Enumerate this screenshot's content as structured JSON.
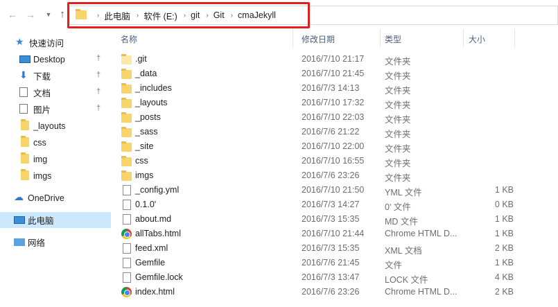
{
  "address_bar": {
    "breadcrumbs": [
      "此电脑",
      "软件 (E:)",
      "git",
      "Git",
      "cmaJekyll"
    ]
  },
  "sidebar": {
    "items": [
      {
        "label": "快速访问",
        "icon": "star-icon",
        "pinned": false,
        "selected": false
      },
      {
        "label": "Desktop",
        "icon": "desktop-icon",
        "pinned": true,
        "selected": false
      },
      {
        "label": "下载",
        "icon": "download-icon",
        "pinned": true,
        "selected": false
      },
      {
        "label": "文档",
        "icon": "document-icon",
        "pinned": true,
        "selected": false
      },
      {
        "label": "图片",
        "icon": "pictures-icon",
        "pinned": true,
        "selected": false
      },
      {
        "label": "_layouts",
        "icon": "folder-icon",
        "pinned": false,
        "selected": false
      },
      {
        "label": "css",
        "icon": "folder-icon",
        "pinned": false,
        "selected": false
      },
      {
        "label": "img",
        "icon": "folder-icon",
        "pinned": false,
        "selected": false
      },
      {
        "label": "imgs",
        "icon": "folder-icon",
        "pinned": false,
        "selected": false
      },
      {
        "label": "OneDrive",
        "icon": "cloud-icon",
        "pinned": false,
        "selected": false
      },
      {
        "label": "此电脑",
        "icon": "computer-icon",
        "pinned": false,
        "selected": true
      },
      {
        "label": "网络",
        "icon": "network-icon",
        "pinned": false,
        "selected": false
      }
    ]
  },
  "columns": {
    "name": "名称",
    "date": "修改日期",
    "type": "类型",
    "size": "大小"
  },
  "files": [
    {
      "name": ".git",
      "date": "2016/7/10 21:17",
      "type": "文件夹",
      "size": "",
      "icon": "folder-light"
    },
    {
      "name": "_data",
      "date": "2016/7/10 21:45",
      "type": "文件夹",
      "size": "",
      "icon": "folder"
    },
    {
      "name": "_includes",
      "date": "2016/7/3 14:13",
      "type": "文件夹",
      "size": "",
      "icon": "folder"
    },
    {
      "name": "_layouts",
      "date": "2016/7/10 17:32",
      "type": "文件夹",
      "size": "",
      "icon": "folder"
    },
    {
      "name": "_posts",
      "date": "2016/7/10 22:03",
      "type": "文件夹",
      "size": "",
      "icon": "folder"
    },
    {
      "name": "_sass",
      "date": "2016/7/6 21:22",
      "type": "文件夹",
      "size": "",
      "icon": "folder"
    },
    {
      "name": "_site",
      "date": "2016/7/10 22:00",
      "type": "文件夹",
      "size": "",
      "icon": "folder"
    },
    {
      "name": "css",
      "date": "2016/7/10 16:55",
      "type": "文件夹",
      "size": "",
      "icon": "folder"
    },
    {
      "name": "imgs",
      "date": "2016/7/6 23:26",
      "type": "文件夹",
      "size": "",
      "icon": "folder"
    },
    {
      "name": "_config.yml",
      "date": "2016/7/10 21:50",
      "type": "YML 文件",
      "size": "1 KB",
      "icon": "document"
    },
    {
      "name": "0.1.0'",
      "date": "2016/7/3 14:27",
      "type": "0' 文件",
      "size": "0 KB",
      "icon": "document"
    },
    {
      "name": "about.md",
      "date": "2016/7/3 15:35",
      "type": "MD 文件",
      "size": "1 KB",
      "icon": "document"
    },
    {
      "name": "allTabs.html",
      "date": "2016/7/10 21:44",
      "type": "Chrome HTML D...",
      "size": "1 KB",
      "icon": "chrome"
    },
    {
      "name": "feed.xml",
      "date": "2016/7/3 15:35",
      "type": "XML 文档",
      "size": "2 KB",
      "icon": "document"
    },
    {
      "name": "Gemfile",
      "date": "2016/7/6 21:45",
      "type": "文件",
      "size": "1 KB",
      "icon": "document"
    },
    {
      "name": "Gemfile.lock",
      "date": "2016/7/3 13:47",
      "type": "LOCK 文件",
      "size": "4 KB",
      "icon": "document"
    },
    {
      "name": "index.html",
      "date": "2016/7/6 23:26",
      "type": "Chrome HTML D...",
      "size": "2 KB",
      "icon": "chrome"
    }
  ],
  "colors": {
    "highlight_box": "#e0211e",
    "selection": "#cce8ff",
    "folder": "#f8d56b"
  }
}
